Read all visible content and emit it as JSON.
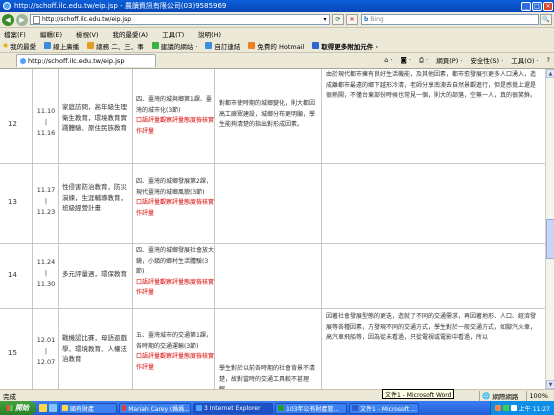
{
  "window": {
    "title": "http://schoff.ilc.edu.tw/eip.jsp - 農讀資訊有限公司(03)9585969"
  },
  "address": {
    "url": "http://schoff.ilc.edu.tw/eip.jsp"
  },
  "search": {
    "engine": "b",
    "placeholder": "Bing"
  },
  "menu": [
    "檔案(F)",
    "編輯(E)",
    "檢視(V)",
    "我的最愛(A)",
    "工具(T)",
    "說明(H)"
  ],
  "favorites": {
    "label": "我的最愛",
    "items": [
      "線上廣播",
      "總務 二、三、事",
      "建議的網站 ·",
      "自訂連結",
      "免費的 Hotmail",
      "取得更多附加元件 ·"
    ]
  },
  "tab": {
    "title": "http://schoff.ilc.edu.tw/eip.jsp"
  },
  "tools": [
    "網頁(P) ·",
    "安全性(S) ·",
    "工具(O) ·",
    "?"
  ],
  "rows": [
    {
      "num": "12",
      "date_start": "11.10",
      "date_sep": "|",
      "date_end": "11.16",
      "topic": "家庭訪問，高年級生理衛生教育，環境教育實踐體驗、原住民族教育",
      "unit": "四、臺灣的城與鄉第1課、臺灣的城市化(3節)",
      "unit_red": "口語評量觀察評量態度檢核實作評量",
      "objective": "對都市使時期的城鄉變化，則大都因高工廠眾建設，城鄉分布更明顯，學生能夠清楚的指出對形成因素。",
      "desc": "由於現代都市擁有良好生活機能，及其他因素，都市愈發展引更多人口湧入，造成離都市最遠的鄉下越形冷清，老師分享南澳去自然景觀進行，但是感覺上還是很熱鬧，不僅台東部份時候也常見一個，則大的部落，空無一人，真的很笑鮮。"
    },
    {
      "num": "13",
      "date_start": "11.17",
      "date_sep": "|",
      "date_end": "11.23",
      "topic": "性侵害防治教育，防災演練，生涯輔導教育，班級經營計畫",
      "unit": "四、臺灣的城鄉發展第2課，現代臺灣的城鄉風貌(3節)",
      "unit_red": "口語評量觀察評量態度檢核實作評量",
      "objective": "",
      "desc": ""
    },
    {
      "num": "14",
      "date_start": "11.24",
      "date_sep": "|",
      "date_end": "11.30",
      "topic": "多元評量週，環保教育",
      "unit": "四、臺灣的城鄉發展社會放大鏡，小鎮的鄉村生活體驗(3節)",
      "unit_red": "口語評量觀察評量態度檢核實作評量",
      "objective": "",
      "desc": ""
    },
    {
      "num": "15",
      "date_start": "12.01",
      "date_sep": "|",
      "date_end": "12.07",
      "topic": "戰機認比賽，母語遊戲學、環境教育、人權法治教育",
      "unit": "五、臺灣城市的交通第1課，各時期的交通運輸(3節)",
      "unit_red": "口語評量觀察評量態度檢核實作評量",
      "objective": "學生對於以前各時期的社會背景不清楚，故對當時的交通工具較不甚理解。",
      "desc": "因著社會發展型態的更迭，造就了不同的交通需求，再因著地形、人口、經濟發展等各種因素，方發現不同的交通方式，學生對於一般交通方式，如腳汽火車，高汽車飛船等，因為從未看過，只從電視或電影中看過，所以"
    }
  ],
  "status": {
    "text": "完成",
    "zone": "網際網路",
    "zoom": "100%"
  },
  "taskbar": {
    "start": "開始",
    "items": [
      "國有財產",
      "Mariah Carey (媽媽...",
      "3 Internet Explorer",
      "103年公有財產管...",
      "文件1 - Microsoft ..."
    ],
    "time": "上午 11:27"
  },
  "tooltip": "文件1 - Microsoft Word"
}
